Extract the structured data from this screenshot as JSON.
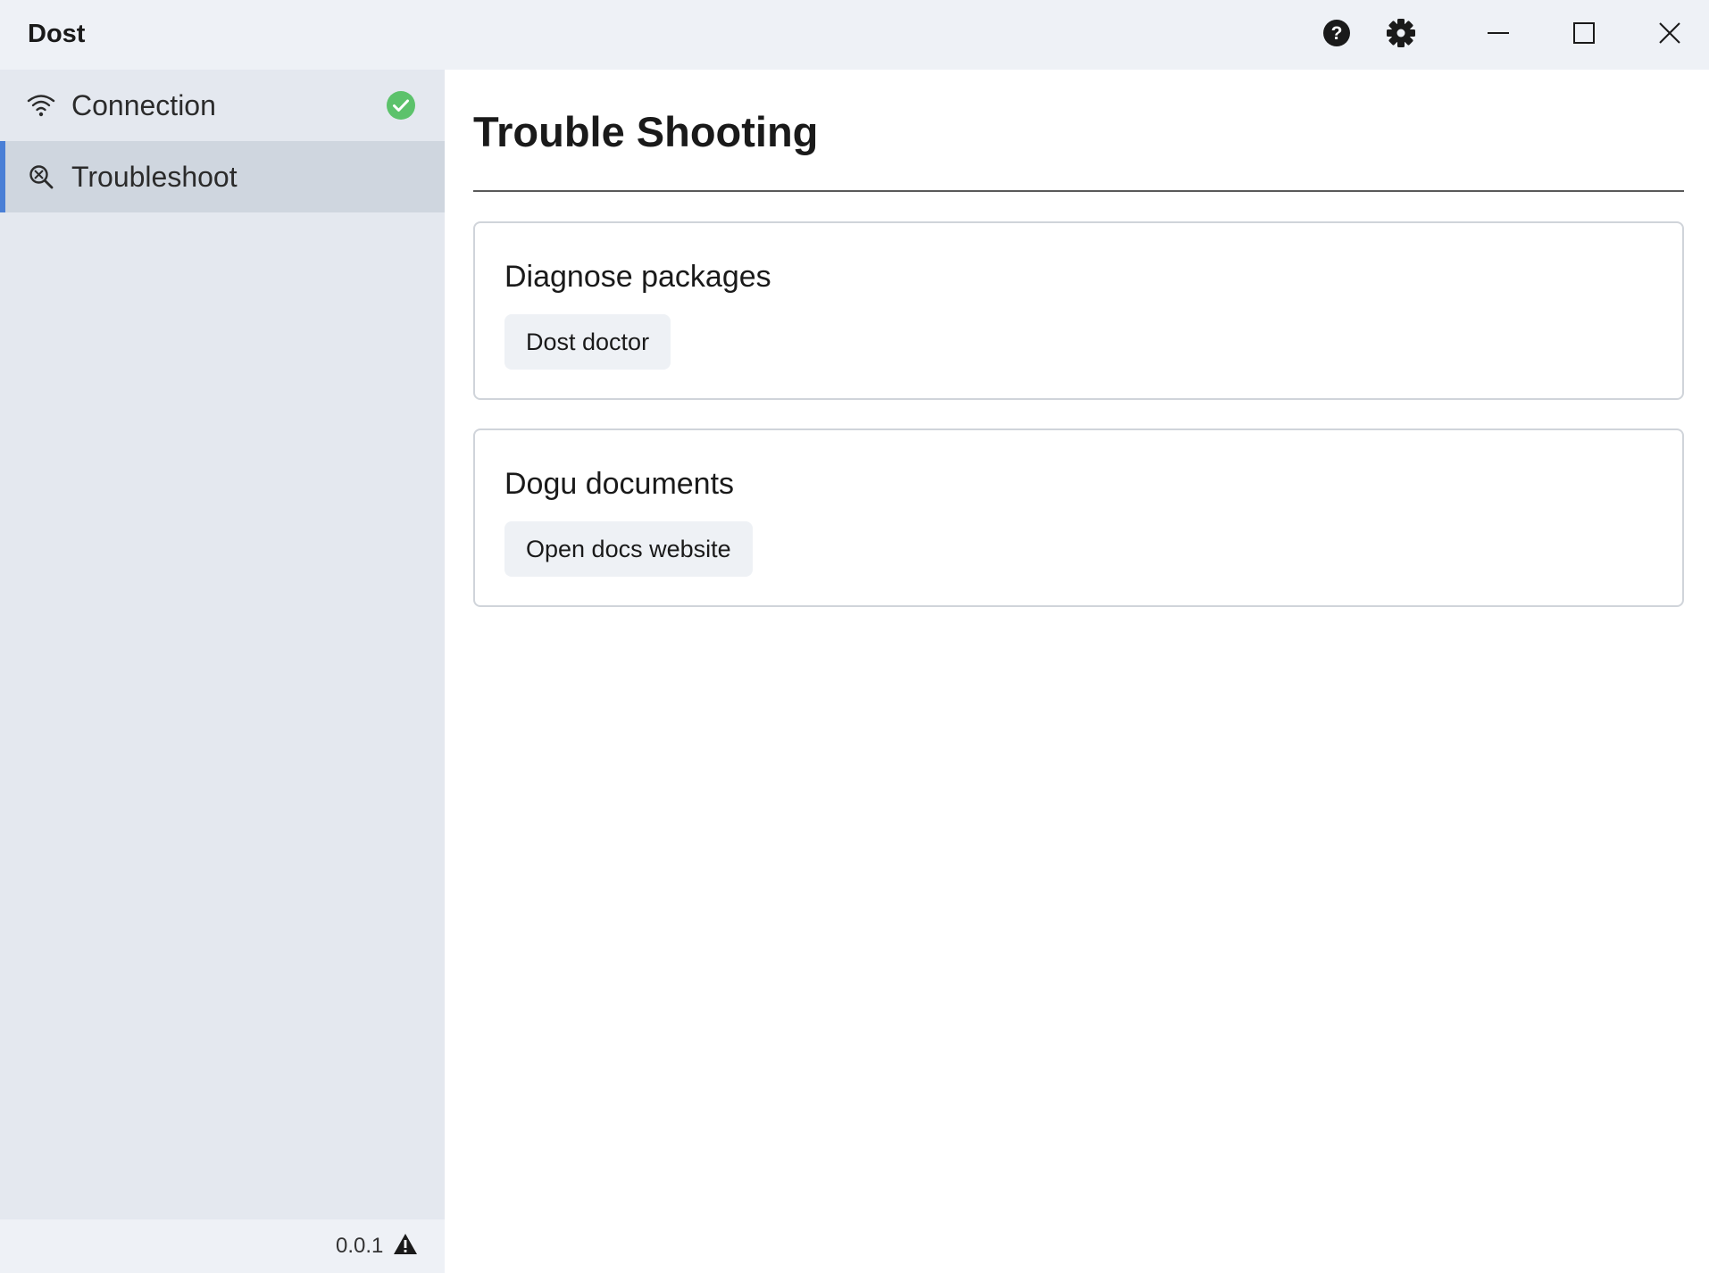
{
  "window": {
    "title": "Dost",
    "icons": {
      "help": "help-icon",
      "settings": "gear-icon",
      "minimize": "minimize-icon",
      "maximize": "maximize-icon",
      "close": "close-icon"
    }
  },
  "sidebar": {
    "items": [
      {
        "label": "Connection",
        "icon": "wifi-icon",
        "status": "connected-check-icon",
        "active": false
      },
      {
        "label": "Troubleshoot",
        "icon": "search-bug-icon",
        "active": true
      }
    ],
    "footer": {
      "version": "0.0.1",
      "icon": "warning-icon"
    }
  },
  "main": {
    "title": "Trouble Shooting",
    "cards": [
      {
        "title": "Diagnose packages",
        "button_label": "Dost doctor"
      },
      {
        "title": "Dogu documents",
        "button_label": "Open docs website"
      }
    ]
  },
  "colors": {
    "accent": "#4a7fd6",
    "success": "#5cc26b",
    "titlebar_bg": "#eef1f6",
    "sidebar_bg": "#e4e8ef",
    "sidebar_active_bg": "#cfd6df"
  }
}
